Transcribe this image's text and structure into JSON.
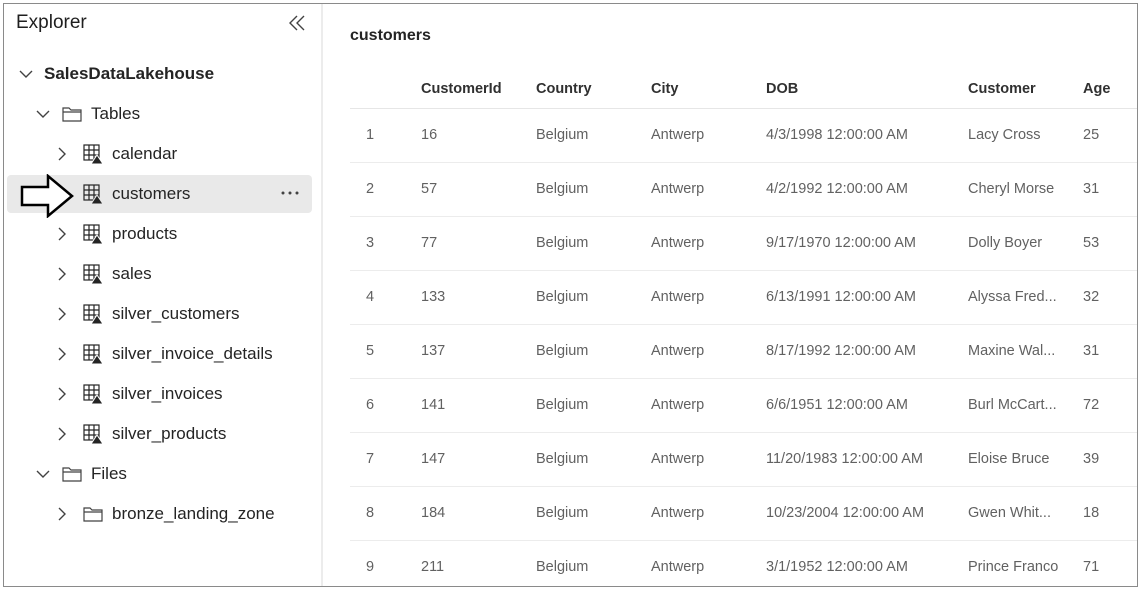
{
  "explorer": {
    "title": "Explorer",
    "lakehouse": "SalesDataLakehouse",
    "tables_folder": "Tables",
    "tables": [
      {
        "label": "calendar"
      },
      {
        "label": "customers",
        "selected": true
      },
      {
        "label": "products"
      },
      {
        "label": "sales"
      },
      {
        "label": "silver_customers"
      },
      {
        "label": "silver_invoice_details"
      },
      {
        "label": "silver_invoices"
      },
      {
        "label": "silver_products"
      }
    ],
    "files_folder": "Files",
    "files": [
      {
        "label": "bronze_landing_zone"
      }
    ],
    "icons": {
      "collapse": "double-chevron-left-icon",
      "table": "delta-table-icon",
      "folder": "folder-icon",
      "more": "more-options-icon",
      "pointer": "arrow-right-outline-icon"
    }
  },
  "table": {
    "title": "customers",
    "columns": [
      "CustomerId",
      "Country",
      "City",
      "DOB",
      "Customer",
      "Age"
    ],
    "rows": [
      {
        "idx": "1",
        "id": "16",
        "country": "Belgium",
        "city": "Antwerp",
        "dob": "4/3/1998 12:00:00 AM",
        "customer": "Lacy Cross",
        "age": "25"
      },
      {
        "idx": "2",
        "id": "57",
        "country": "Belgium",
        "city": "Antwerp",
        "dob": "4/2/1992 12:00:00 AM",
        "customer": "Cheryl Morse",
        "age": "31"
      },
      {
        "idx": "3",
        "id": "77",
        "country": "Belgium",
        "city": "Antwerp",
        "dob": "9/17/1970 12:00:00 AM",
        "customer": "Dolly Boyer",
        "age": "53"
      },
      {
        "idx": "4",
        "id": "133",
        "country": "Belgium",
        "city": "Antwerp",
        "dob": "6/13/1991 12:00:00 AM",
        "customer": "Alyssa Fred...",
        "age": "32"
      },
      {
        "idx": "5",
        "id": "137",
        "country": "Belgium",
        "city": "Antwerp",
        "dob": "8/17/1992 12:00:00 AM",
        "customer": "Maxine Wal...",
        "age": "31"
      },
      {
        "idx": "6",
        "id": "141",
        "country": "Belgium",
        "city": "Antwerp",
        "dob": "6/6/1951 12:00:00 AM",
        "customer": "Burl McCart...",
        "age": "72"
      },
      {
        "idx": "7",
        "id": "147",
        "country": "Belgium",
        "city": "Antwerp",
        "dob": "11/20/1983 12:00:00 AM",
        "customer": "Eloise Bruce",
        "age": "39"
      },
      {
        "idx": "8",
        "id": "184",
        "country": "Belgium",
        "city": "Antwerp",
        "dob": "10/23/2004 12:00:00 AM",
        "customer": "Gwen Whit...",
        "age": "18"
      },
      {
        "idx": "9",
        "id": "211",
        "country": "Belgium",
        "city": "Antwerp",
        "dob": "3/1/1952 12:00:00 AM",
        "customer": "Prince Franco",
        "age": "71"
      }
    ]
  },
  "colors": {
    "selected_row_bg": "#e9e9e9",
    "text": "#242424",
    "muted_text": "#616161"
  }
}
